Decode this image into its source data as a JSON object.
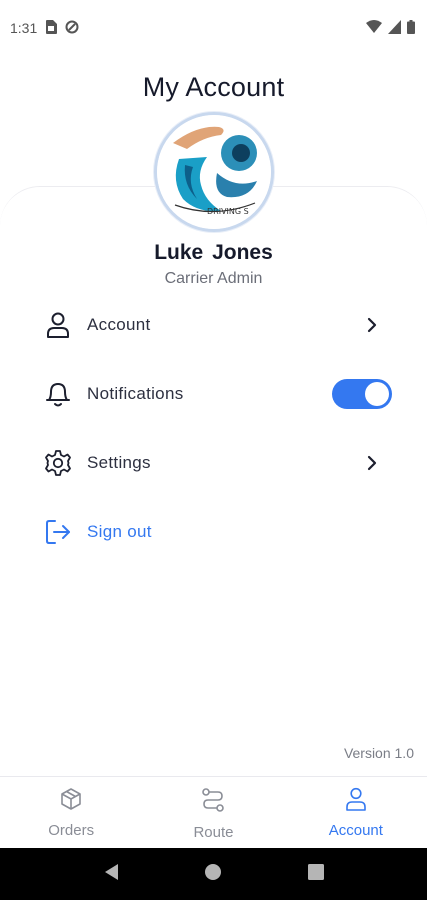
{
  "status_bar": {
    "time": "1:31",
    "icons": [
      "sim-card-icon",
      "data-saver-icon",
      "wifi-icon",
      "signal-icon",
      "battery-icon"
    ]
  },
  "header": {
    "title": "My Account"
  },
  "profile": {
    "name": "Luke  Jones",
    "role": "Carrier Admin",
    "logo_text": "DRIVING S"
  },
  "menu": {
    "account_label": "Account",
    "notifications_label": "Notifications",
    "notifications_enabled": true,
    "settings_label": "Settings",
    "signout_label": "Sign out"
  },
  "footer": {
    "version": "Version 1.0"
  },
  "bottom_nav": {
    "items": [
      {
        "label": "Orders",
        "icon": "box-icon",
        "active": false
      },
      {
        "label": "Route",
        "icon": "route-icon",
        "active": false
      },
      {
        "label": "Account",
        "icon": "person-icon",
        "active": true
      }
    ]
  },
  "colors": {
    "accent": "#3478f0",
    "text": "#161a2b",
    "muted": "#6b6e78"
  }
}
